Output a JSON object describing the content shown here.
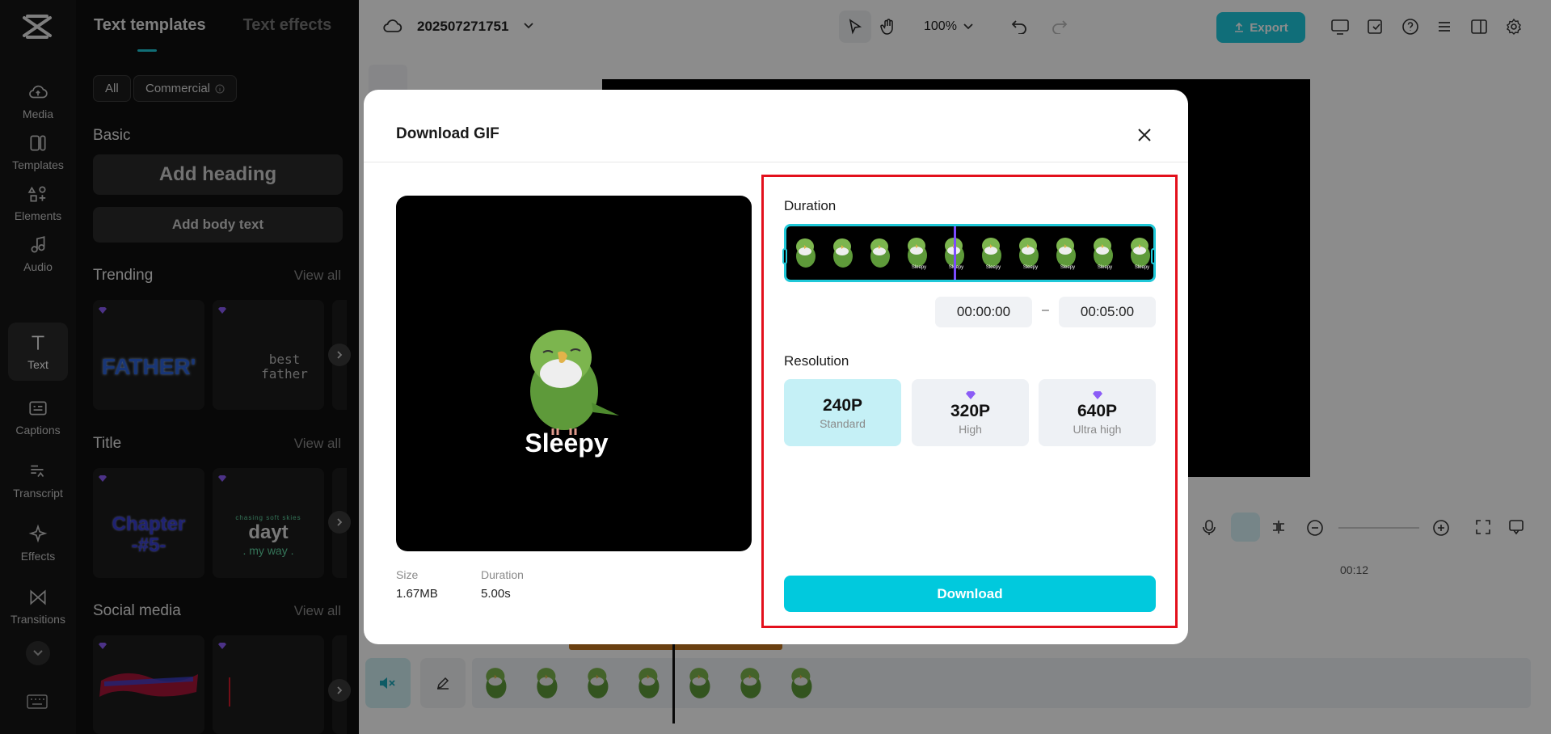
{
  "rail": {
    "items": [
      {
        "label": "Media",
        "icon": "cloud-upload-icon"
      },
      {
        "label": "Templates",
        "icon": "templates-icon"
      },
      {
        "label": "Elements",
        "icon": "elements-icon"
      },
      {
        "label": "Audio",
        "icon": "music-note-icon"
      },
      {
        "label": "Text",
        "icon": "text-icon"
      },
      {
        "label": "Captions",
        "icon": "captions-icon"
      },
      {
        "label": "Transcript",
        "icon": "transcript-icon"
      },
      {
        "label": "Effects",
        "icon": "sparkle-icon"
      },
      {
        "label": "Transitions",
        "icon": "transitions-icon"
      }
    ],
    "active": "Text"
  },
  "panel": {
    "tab_active": "Text templates",
    "tab_inactive": "Text effects",
    "chip_all": "All",
    "chip_commercial": "Commercial",
    "basic_title": "Basic",
    "add_heading": "Add heading",
    "add_body": "Add body text",
    "trending_title": "Trending",
    "title_section": "Title",
    "social_title": "Social media",
    "view_all": "View all",
    "trend_card1": "FATHER'",
    "trend_card2a": "best",
    "trend_card2b": "father",
    "title_card1a": "Chapter",
    "title_card1b": "-#5-",
    "title_card2a": "chasing soft skies",
    "title_card2b": "dayt",
    "title_card2c": ". my way ."
  },
  "topbar": {
    "project_name": "202507271751",
    "zoom": "100%",
    "export_label": "Export"
  },
  "timeline": {
    "time_marker": "00:12"
  },
  "modal": {
    "title": "Download GIF",
    "preview_caption": "Sleepy",
    "size_label": "Size",
    "size_value": "1.67MB",
    "duration_label": "Duration",
    "duration_value": "5.00s",
    "settings": {
      "duration_title": "Duration",
      "start_time": "00:00:00",
      "end_time": "00:05:00",
      "range_separator": "–",
      "resolution_title": "Resolution",
      "resolutions": [
        {
          "value": "240P",
          "name": "Standard",
          "premium": false,
          "selected": true
        },
        {
          "value": "320P",
          "name": "High",
          "premium": true,
          "selected": false
        },
        {
          "value": "640P",
          "name": "Ultra high",
          "premium": true,
          "selected": false
        }
      ],
      "download_label": "Download"
    },
    "filmstrip_frame_label": "Sleepy"
  },
  "colors": {
    "accent": "#01c9dd",
    "highlight_border": "#e3101c",
    "premium_gem": "#8b5cf6",
    "selected_card": "#c5f0f6"
  }
}
